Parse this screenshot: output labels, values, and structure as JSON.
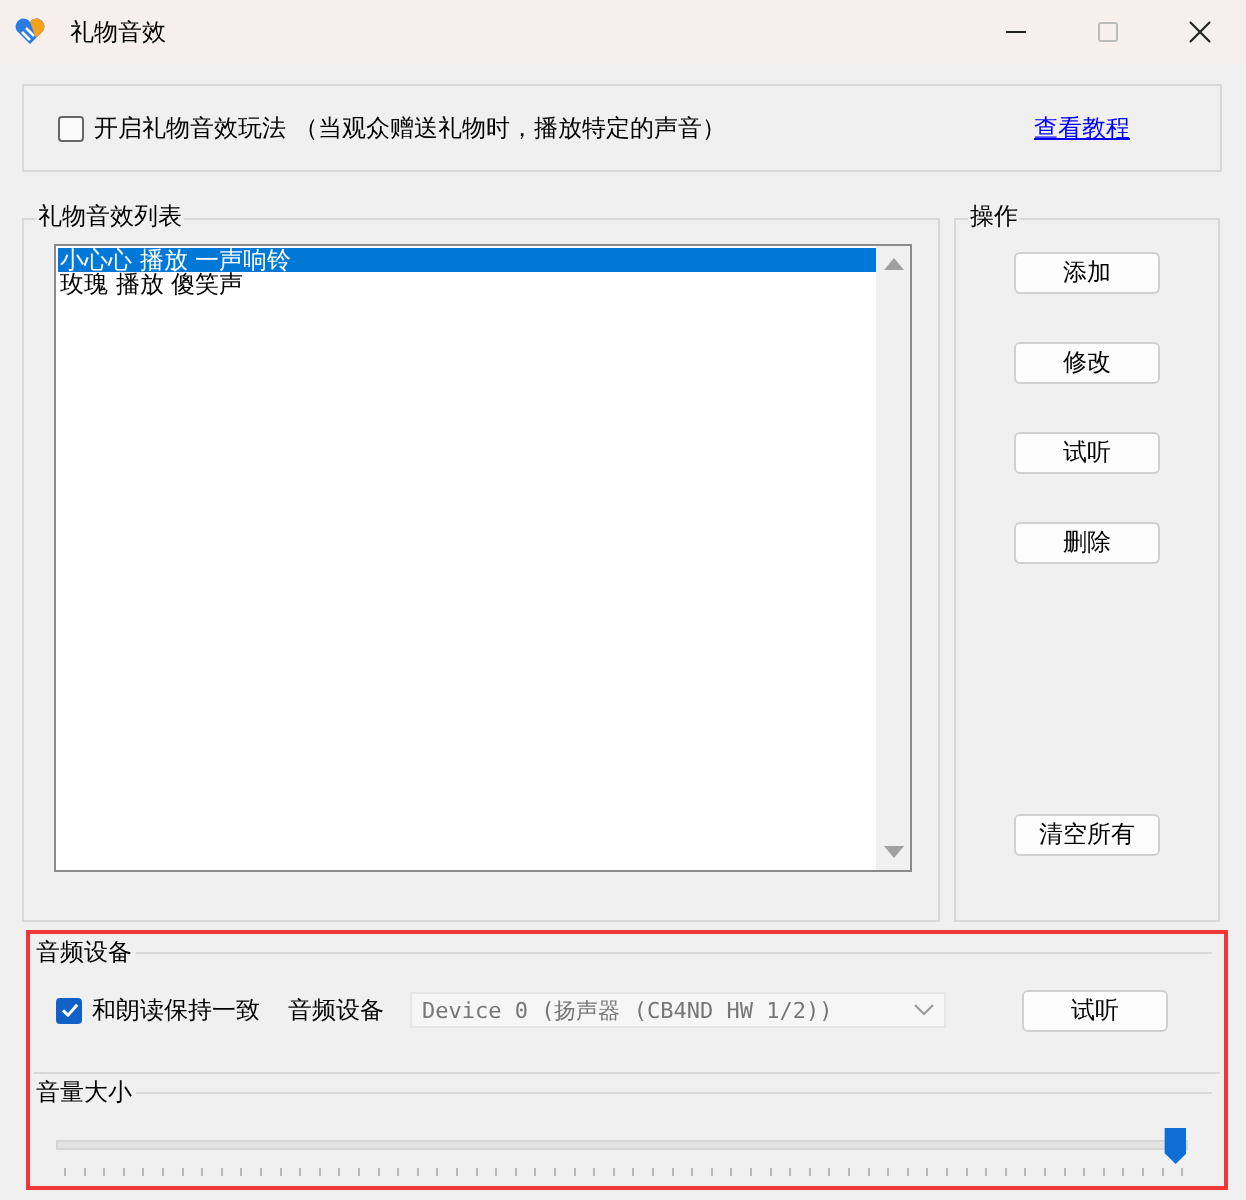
{
  "window": {
    "title": "礼物音效"
  },
  "enable": {
    "label": "开启礼物音效玩法 （当观众赠送礼物时，播放特定的声音）",
    "checked": false
  },
  "tutorial_link": "查看教程",
  "sound_list": {
    "title": "礼物音效列表",
    "items": [
      {
        "label": "小心心 播放 一声响铃",
        "selected": true
      },
      {
        "label": "玫瑰 播放 傻笑声",
        "selected": false
      }
    ]
  },
  "actions": {
    "title": "操作",
    "buttons": [
      "添加",
      "修改",
      "试听",
      "删除"
    ],
    "bottom_button": "清空所有"
  },
  "audio_device": {
    "title": "音频设备",
    "sync": {
      "label": "和朗读保持一致",
      "checked": true
    },
    "device_label": "音频设备",
    "device": {
      "value": "Device 0 (扬声器 (CB4ND HW 1/2))",
      "disabled": true
    },
    "test_button": "试听"
  },
  "volume": {
    "title": "音量大小",
    "level": 0.99
  }
}
